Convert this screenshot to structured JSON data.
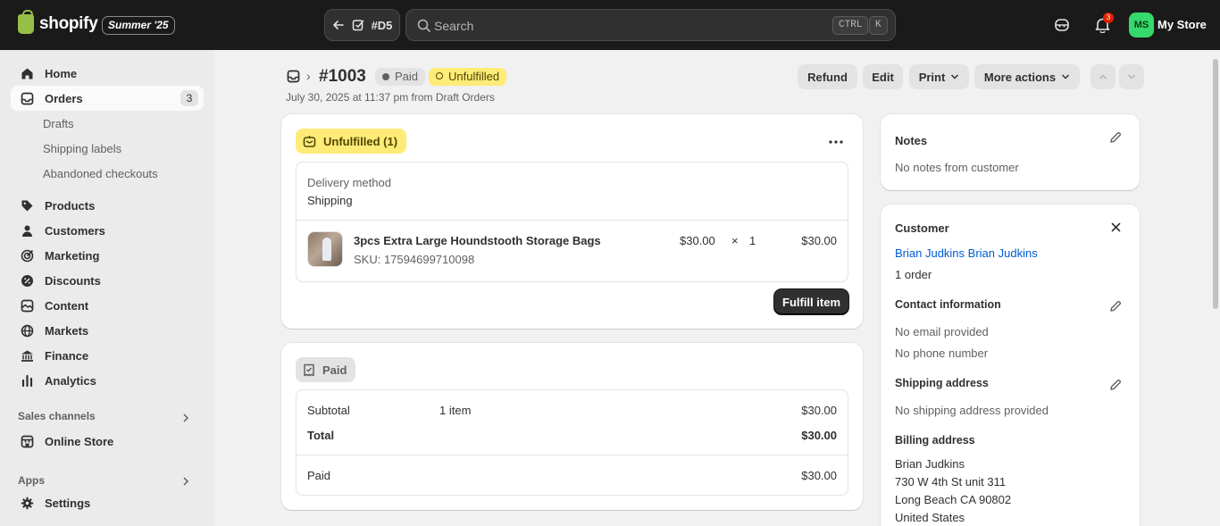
{
  "topbar": {
    "logo_text": "shopify",
    "edition": "Summer '25",
    "back_label": "#D5",
    "search_placeholder": "Search",
    "shortcut_ctrl": "CTRL",
    "shortcut_key": "K",
    "notification_count": "3",
    "avatar_initials": "MS",
    "store_name": "My Store"
  },
  "sidebar": {
    "home": "Home",
    "orders": "Orders",
    "orders_count": "3",
    "drafts": "Drafts",
    "shipping_labels": "Shipping labels",
    "abandoned_checkouts": "Abandoned checkouts",
    "products": "Products",
    "customers": "Customers",
    "marketing": "Marketing",
    "discounts": "Discounts",
    "content": "Content",
    "markets": "Markets",
    "finance": "Finance",
    "analytics": "Analytics",
    "sales_channels": "Sales channels",
    "online_store": "Online Store",
    "apps": "Apps",
    "settings": "Settings"
  },
  "header": {
    "order_number": "#1003",
    "payment_badge": "Paid",
    "fulfillment_badge": "Unfulfilled",
    "subline": "July 30, 2025 at 11:37 pm from Draft Orders",
    "refund": "Refund",
    "edit": "Edit",
    "print": "Print",
    "more_actions": "More actions"
  },
  "fulfillment": {
    "status": "Unfulfilled (1)",
    "delivery_method_label": "Delivery method",
    "delivery_method": "Shipping",
    "item_name": "3pcs Extra Large Houndstooth Storage Bags",
    "item_sku": "SKU: 17594699710098",
    "item_price": "$30.00",
    "item_times": "×",
    "item_qty": "1",
    "item_total": "$30.00",
    "fulfill_button": "Fulfill item"
  },
  "payment": {
    "status": "Paid",
    "subtotal_label": "Subtotal",
    "subtotal_items": "1 item",
    "subtotal_value": "$30.00",
    "total_label": "Total",
    "total_value": "$30.00",
    "paid_label": "Paid",
    "paid_value": "$30.00"
  },
  "notes": {
    "title": "Notes",
    "text": "No notes from customer"
  },
  "customer": {
    "title": "Customer",
    "name": "Brian Judkins Brian Judkins",
    "orders": "1 order",
    "contact_title": "Contact information",
    "no_email": "No email provided",
    "no_phone": "No phone number",
    "shipping_title": "Shipping address",
    "no_shipping": "No shipping address provided",
    "billing_title": "Billing address",
    "billing_name": "Brian Judkins",
    "billing_street": "730 W 4th St unit 311",
    "billing_city": "Long Beach CA 90802",
    "billing_country": "United States"
  },
  "colors": {
    "topbar": "#1a1a1a",
    "unfulfilled_badge": "#ffeb78",
    "link": "#005bd3",
    "avatar": "#36d96c"
  }
}
